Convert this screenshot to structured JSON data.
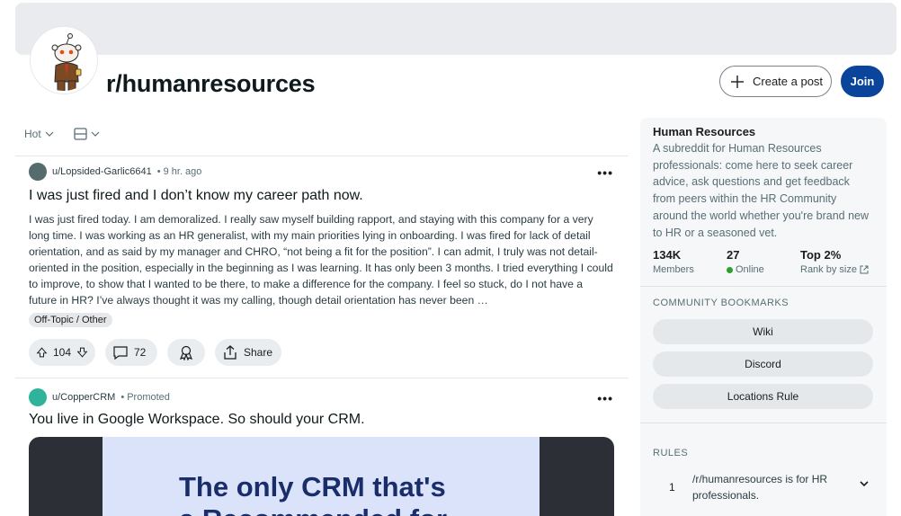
{
  "subreddit": {
    "name": "r/humanresources",
    "create_post_label": "Create a post",
    "join_label": "Join"
  },
  "sortbar": {
    "sort_label": "Hot"
  },
  "posts": [
    {
      "user": "u/Lopsided-Garlic6641",
      "time": "• 9 hr. ago",
      "title": "I was just fired and I don’t know my career path now.",
      "body": "I was just fired today. I am demoralized. I really saw myself building rapport, and staying with this company for a very long time. I was working as an HR generalist, with my main priorities lying in onboarding. I was fired for lack of detail orientation, and as said by my manager and CHRO, “not being a fit for the position”. I can admit, I truly was not detail-oriented in the position, especially in the beginning as I was learning. It has only been 3 months. I tried everything I could to improve, to show that I wanted to be there, to make a difference for the company. I feel so stuck, do I not have a future in HR? I’ve always thought it was my calling, though detail orientation has never been …",
      "flair": "Off-Topic / Other",
      "votes": "104",
      "comments": "72",
      "share_label": "Share"
    },
    {
      "user": "u/CopperCRM",
      "time": "• Promoted",
      "title": "You live in Google Workspace. So should your CRM.",
      "ad_text_line1": "The only CRM that's",
      "ad_text_line2": "a Recommended for"
    }
  ],
  "sidebar": {
    "name": "Human Resources",
    "description": "A subreddit for Human Resources professionals: come here to seek career advice, ask questions and get feedback from peers within the HR Community around the world whether you're brand new to HR or a seasoned vet.",
    "stats": [
      {
        "num": "134K",
        "label": "Members"
      },
      {
        "num": "27",
        "label": "Online"
      },
      {
        "num": "Top 2%",
        "label": "Rank by size"
      }
    ],
    "bookmarks_heading": "COMMUNITY BOOKMARKS",
    "bookmarks": [
      "Wiki",
      "Discord",
      "Locations Rule"
    ],
    "rules_heading": "RULES",
    "rules": [
      {
        "n": "1",
        "text": "/r/humanresources is for HR professionals."
      }
    ]
  },
  "colors": {
    "join": "#0a449b",
    "pill": "#eaedef",
    "banner": "#e9ebee",
    "online": "#2aa22a"
  },
  "icons": [
    "snoo-avatar",
    "plus-icon",
    "chevron-down-icon",
    "layout-icon",
    "upvote-icon",
    "downvote-icon",
    "comment-icon",
    "award-icon",
    "share-icon",
    "more-icon",
    "external-link-icon"
  ]
}
